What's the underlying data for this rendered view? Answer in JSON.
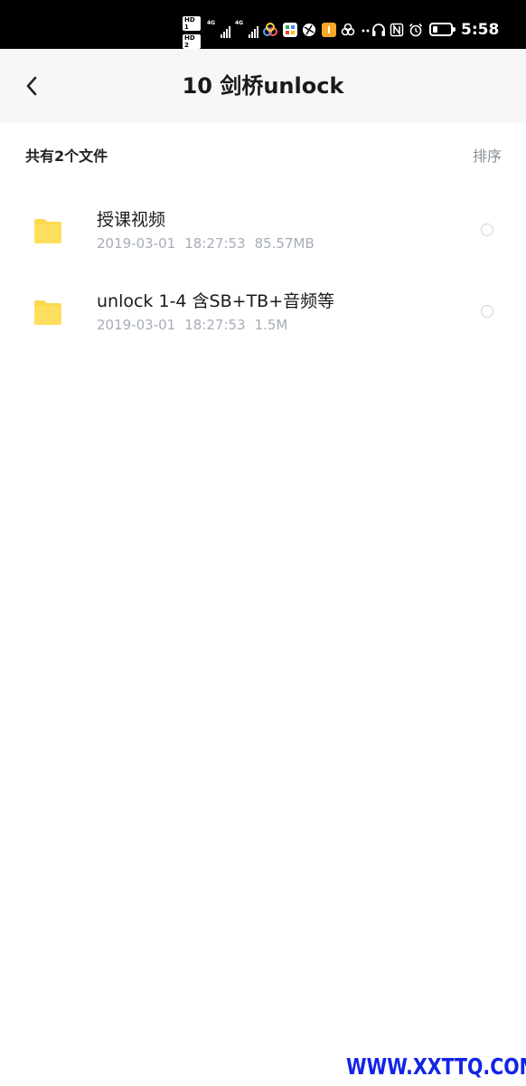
{
  "status_bar": {
    "time": "5:58",
    "hd1": "HD 1",
    "hd2": "HD 2",
    "signal1_label": "4G",
    "signal2_label": "4G",
    "battery_percent": 30
  },
  "header": {
    "title": "10 剑桥unlock",
    "back_icon": "chevron-left-icon"
  },
  "summary": {
    "file_count": "共有2个文件",
    "sort_label": "排序"
  },
  "files": [
    {
      "name": "授课视频",
      "date": "2019-03-01",
      "time": "18:27:53",
      "size": "85.57MB",
      "icon": "folder-icon"
    },
    {
      "name": "unlock 1-4 含SB+TB+音频等",
      "date": "2019-03-01",
      "time": "18:27:53",
      "size": "1.5M",
      "icon": "folder-icon"
    }
  ],
  "colors": {
    "folder": "#fdd84f",
    "header_bg": "#f7f7f7",
    "meta_text": "#a7adb7",
    "watermark": "#1224e6"
  },
  "watermark": "WWW.XXTTQ.COM"
}
